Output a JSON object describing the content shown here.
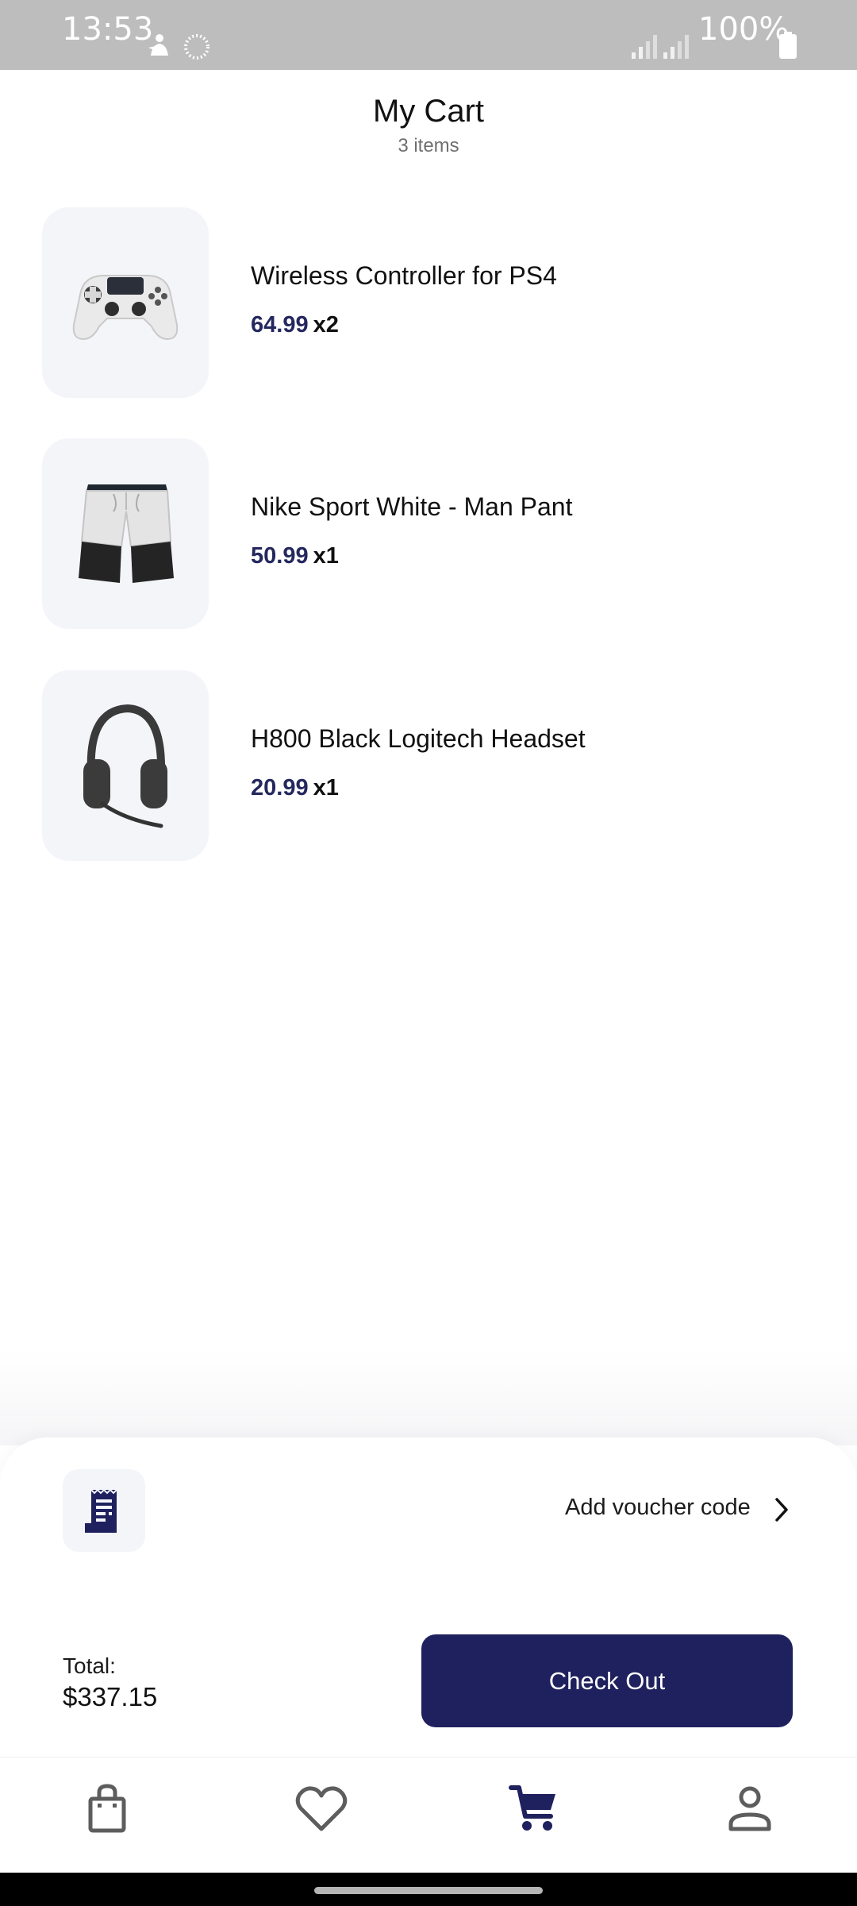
{
  "status_bar": {
    "time": "13:53",
    "battery": "100%"
  },
  "header": {
    "title": "My Cart",
    "subtitle": "3 items"
  },
  "cart": {
    "items": [
      {
        "name": "Wireless Controller for PS4",
        "price": "64.99",
        "qty": "x2",
        "image_icon": "ps4-controller-image"
      },
      {
        "name": "Nike Sport White - Man Pant",
        "price": "50.99",
        "qty": "x1",
        "image_icon": "shorts-image"
      },
      {
        "name": "H800 Black Logitech Headset",
        "price": "20.99",
        "qty": "x1",
        "image_icon": "headset-image"
      }
    ]
  },
  "voucher": {
    "label": "Add voucher code",
    "icon": "receipt-icon"
  },
  "checkout": {
    "total_label": "Total:",
    "total_value": "$337.15",
    "button_label": "Check Out"
  },
  "bottom_nav": {
    "items": [
      {
        "icon": "shopping-bag-icon",
        "active": false
      },
      {
        "icon": "heart-icon",
        "active": false
      },
      {
        "icon": "cart-icon",
        "active": true
      },
      {
        "icon": "profile-icon",
        "active": false
      }
    ]
  },
  "colors": {
    "accent": "#1f215e",
    "price": "#24285e",
    "thumb_bg": "#f4f5f9",
    "status_bar": "#bdbdbd"
  }
}
